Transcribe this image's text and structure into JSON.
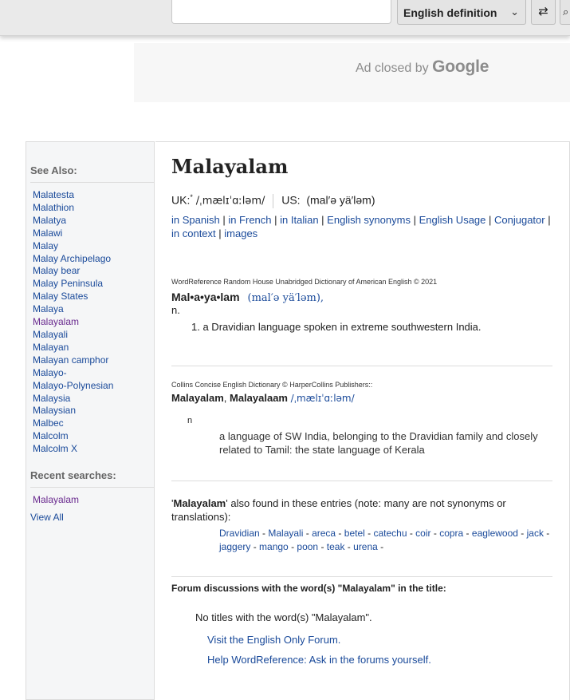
{
  "search": {
    "input_value": "",
    "dictionary_selected": "English definition",
    "swap_symbol": "⇄",
    "go_symbol": "⌕"
  },
  "ad": {
    "prefix": "Ad closed by ",
    "brand": "Google"
  },
  "sidebar": {
    "see_also_heading": "See Also:",
    "see_also": [
      {
        "label": "Malatesta",
        "visited": false
      },
      {
        "label": "Malathion",
        "visited": false
      },
      {
        "label": "Malatya",
        "visited": false
      },
      {
        "label": "Malawi",
        "visited": false
      },
      {
        "label": "Malay",
        "visited": false
      },
      {
        "label": "Malay Archipelago",
        "visited": false
      },
      {
        "label": "Malay bear",
        "visited": false
      },
      {
        "label": "Malay Peninsula",
        "visited": false
      },
      {
        "label": "Malay States",
        "visited": false
      },
      {
        "label": "Malaya",
        "visited": false
      },
      {
        "label": "Malayalam",
        "visited": true
      },
      {
        "label": "Malayali",
        "visited": false
      },
      {
        "label": "Malayan",
        "visited": false
      },
      {
        "label": "Malayan camphor",
        "visited": false
      },
      {
        "label": "Malayo-",
        "visited": false
      },
      {
        "label": "Malayo-Polynesian",
        "visited": false
      },
      {
        "label": "Malaysia",
        "visited": false
      },
      {
        "label": "Malaysian",
        "visited": false
      },
      {
        "label": "Malbec",
        "visited": false
      },
      {
        "label": "Malcolm",
        "visited": false
      },
      {
        "label": "Malcolm X",
        "visited": false
      }
    ],
    "recent_heading": "Recent searches:",
    "recent": [
      "Malayalam"
    ],
    "view_all": "View All"
  },
  "main": {
    "word": "Malayalam",
    "uk_label": "UK:",
    "uk_sup": "*",
    "uk_ipa": "/ˌmælɪˈɑːləm/",
    "us_label": "US:",
    "us_pron": "(mal′ə yä′ləm)",
    "links": [
      "in Spanish",
      "in French",
      "in Italian",
      "English synonyms",
      "English Usage",
      "Conjugator",
      "in context",
      "images"
    ],
    "wr": {
      "source": "WordReference Random House Unabridged Dictionary of American English © 2021",
      "headword": "Mal•a•ya•lam",
      "pron": "(mal′ə yä′ləm),",
      "pos": "n.",
      "def_num": "1.",
      "definition": "a Dravidian language spoken in extreme southwestern India."
    },
    "collins": {
      "source": "Collins Concise English Dictionary © HarperCollins Publishers::",
      "headword1": "Malayalam",
      "comma": ", ",
      "headword2": "Malayalaam",
      "ipa": "/ˌmælɪˈɑːləm/",
      "pos": "n",
      "definition": "a language of SW India, belonging to the Dravidian family and closely related to Tamil: the state language of Kerala"
    },
    "also_found": {
      "quote_open": "'",
      "word": "Malayalam",
      "text": "' also found in these entries (note: many are not synonyms or translations):",
      "entries": [
        "Dravidian",
        "Malayali",
        "areca",
        "betel",
        "catechu",
        "coir",
        "copra",
        "eaglewood",
        "jack",
        "jaggery",
        "mango",
        "poon",
        "teak",
        "urena"
      ]
    },
    "forum": {
      "heading": "Forum discussions with the word(s) \"Malayalam\" in the title:",
      "none": "No titles with the word(s) \"Malayalam\".",
      "link1": "Visit the English Only Forum.",
      "link2": "Help WordReference: Ask in the forums yourself."
    }
  }
}
